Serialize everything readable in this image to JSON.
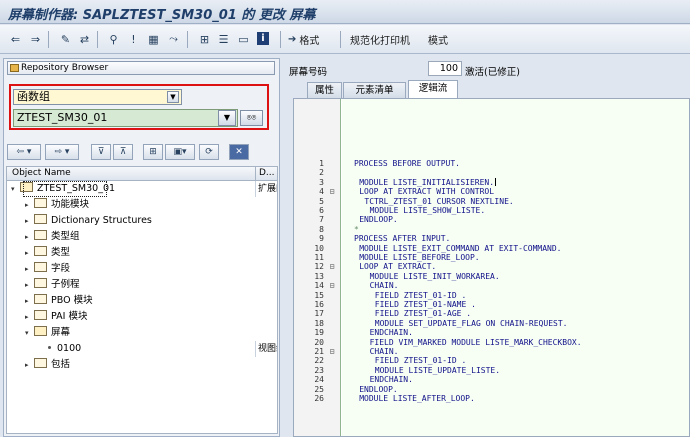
{
  "window": {
    "title": "屏幕制作器: SAPLZTEST_SM30_01 的 更改 屏幕"
  },
  "toolbar": {
    "items": [
      {
        "name": "back-icon",
        "glyph": "⇐"
      },
      {
        "name": "forward-icon",
        "glyph": "⇒"
      },
      {
        "name": "edit-toggle-icon",
        "glyph": "✎"
      },
      {
        "name": "display-change-icon",
        "glyph": "⇄"
      },
      {
        "name": "check-icon",
        "glyph": "⚲"
      },
      {
        "name": "activate-icon",
        "glyph": "!"
      },
      {
        "name": "layout-icon",
        "glyph": "▦"
      },
      {
        "name": "where-used-icon",
        "glyph": "⤳"
      },
      {
        "name": "hierarchy-icon",
        "glyph": "⊞"
      },
      {
        "name": "object-list-icon",
        "glyph": "☰"
      },
      {
        "name": "window-icon",
        "glyph": "▭"
      },
      {
        "name": "info-icon",
        "glyph": "i"
      }
    ],
    "format_label": "格式",
    "pretty_printer_label": "规范化打印机",
    "pattern_label": "模式"
  },
  "left": {
    "repository_browser_label": "Repository Browser",
    "object_type": "函数组",
    "object_name": "ZTEST_SM30_01",
    "tree_header": {
      "col1": "Object Name",
      "col2": "D..."
    },
    "tree": [
      {
        "label": "ZTEST_SM30_01",
        "level": 0,
        "kind": "folder-open",
        "side": "扩展的"
      },
      {
        "label": "功能模块",
        "level": 1,
        "kind": "folder"
      },
      {
        "label": "Dictionary Structures",
        "level": 1,
        "kind": "folder"
      },
      {
        "label": "类型组",
        "level": 1,
        "kind": "folder"
      },
      {
        "label": "类型",
        "level": 1,
        "kind": "folder"
      },
      {
        "label": "字段",
        "level": 1,
        "kind": "folder"
      },
      {
        "label": "子例程",
        "level": 1,
        "kind": "folder"
      },
      {
        "label": "PBO 模块",
        "level": 1,
        "kind": "folder"
      },
      {
        "label": "PAI 模块",
        "level": 1,
        "kind": "folder"
      },
      {
        "label": "屏幕",
        "level": 1,
        "kind": "folder-open"
      },
      {
        "label": "0100",
        "level": 2,
        "kind": "leaf",
        "side": "视图维"
      },
      {
        "label": "包括",
        "level": 1,
        "kind": "folder"
      }
    ]
  },
  "right": {
    "screen_no_label": "屏幕号码",
    "screen_no": "100",
    "screen_status": "激活(已修正)",
    "tabs": [
      "属性",
      "元素清单",
      "逻辑流"
    ],
    "active_tab": 2,
    "code_lines": [
      {
        "n": "1",
        "fold": "",
        "indent": 0,
        "text": "PROCESS BEFORE OUTPUT."
      },
      {
        "n": "2",
        "fold": "",
        "indent": 0,
        "text": ""
      },
      {
        "n": "3",
        "fold": "",
        "indent": 1,
        "text": "MODULE LISTE_INITIALISIEREN."
      },
      {
        "n": "4",
        "fold": "⊟",
        "indent": 1,
        "text": "LOOP AT EXTRACT WITH CONTROL"
      },
      {
        "n": "5",
        "fold": "",
        "indent": 2,
        "text": "TCTRL_ZTEST_01 CURSOR NEXTLINE."
      },
      {
        "n": "6",
        "fold": "",
        "indent": 3,
        "text": "MODULE LISTE_SHOW_LISTE."
      },
      {
        "n": "7",
        "fold": "",
        "indent": 1,
        "text": "ENDLOOP."
      },
      {
        "n": "8",
        "fold": "",
        "indent": 0,
        "text": "*",
        "comment": true
      },
      {
        "n": "9",
        "fold": "",
        "indent": 0,
        "text": "PROCESS AFTER INPUT."
      },
      {
        "n": "10",
        "fold": "",
        "indent": 1,
        "text": "MODULE LISTE_EXIT_COMMAND AT EXIT-COMMAND."
      },
      {
        "n": "11",
        "fold": "",
        "indent": 1,
        "text": "MODULE LISTE_BEFORE_LOOP."
      },
      {
        "n": "12",
        "fold": "⊟",
        "indent": 1,
        "text": "LOOP AT EXTRACT."
      },
      {
        "n": "13",
        "fold": "",
        "indent": 3,
        "text": "MODULE LISTE_INIT_WORKAREA."
      },
      {
        "n": "14",
        "fold": "⊟",
        "indent": 3,
        "text": "CHAIN."
      },
      {
        "n": "15",
        "fold": "",
        "indent": 4,
        "text": "FIELD ZTEST_01-ID ."
      },
      {
        "n": "16",
        "fold": "",
        "indent": 4,
        "text": "FIELD ZTEST_01-NAME ."
      },
      {
        "n": "17",
        "fold": "",
        "indent": 4,
        "text": "FIELD ZTEST_01-AGE ."
      },
      {
        "n": "18",
        "fold": "",
        "indent": 4,
        "text": "MODULE SET_UPDATE_FLAG ON CHAIN-REQUEST."
      },
      {
        "n": "19",
        "fold": "",
        "indent": 3,
        "text": "ENDCHAIN."
      },
      {
        "n": "20",
        "fold": "",
        "indent": 3,
        "text": "FIELD VIM_MARKED MODULE LISTE_MARK_CHECKBOX."
      },
      {
        "n": "21",
        "fold": "⊟",
        "indent": 3,
        "text": "CHAIN."
      },
      {
        "n": "22",
        "fold": "",
        "indent": 4,
        "text": "FIELD ZTEST_01-ID ."
      },
      {
        "n": "23",
        "fold": "",
        "indent": 4,
        "text": "MODULE LISTE_UPDATE_LISTE."
      },
      {
        "n": "24",
        "fold": "",
        "indent": 3,
        "text": "ENDCHAIN."
      },
      {
        "n": "25",
        "fold": "",
        "indent": 1,
        "text": "ENDLOOP."
      },
      {
        "n": "26",
        "fold": "",
        "indent": 1,
        "text": "MODULE LISTE_AFTER_LOOP."
      }
    ]
  }
}
